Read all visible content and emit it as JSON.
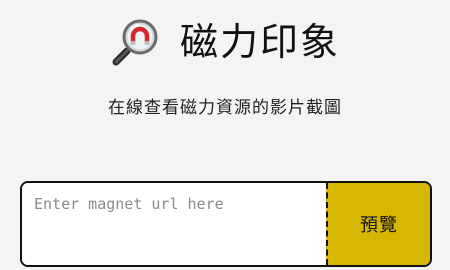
{
  "header": {
    "logo_icon": "magnifying-glass-magnet-icon",
    "title": "磁力印象"
  },
  "subtitle": "在線查看磁力資源的影片截圖",
  "search": {
    "placeholder": "Enter magnet url here",
    "value": "",
    "button_label": "預覽"
  },
  "colors": {
    "background": "#f4f4f5",
    "button": "#d6b703",
    "border": "#111111",
    "magnet_red": "#d62828"
  }
}
